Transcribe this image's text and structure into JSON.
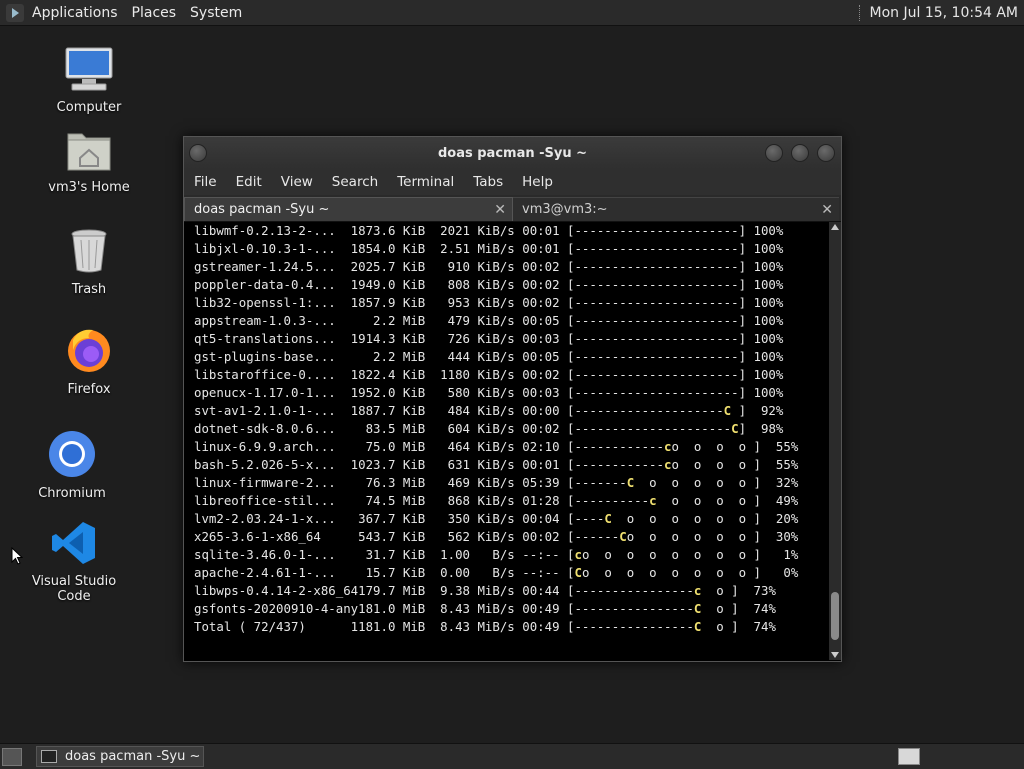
{
  "top_panel": {
    "menus": [
      "Applications",
      "Places",
      "System"
    ],
    "clock": "Mon Jul 15, 10:54 AM"
  },
  "desktop": {
    "icons": [
      {
        "label": "Computer",
        "icon": "computer-icon"
      },
      {
        "label": "vm3's Home",
        "icon": "home-folder-icon"
      },
      {
        "label": "Trash",
        "icon": "trash-icon"
      },
      {
        "label": "Firefox",
        "icon": "firefox-icon"
      },
      {
        "label": "Chromium",
        "icon": "chromium-icon"
      },
      {
        "label": "Visual Studio Code",
        "icon": "vscode-icon"
      }
    ]
  },
  "window": {
    "title": "doas pacman -Syu ~",
    "menu": [
      "File",
      "Edit",
      "View",
      "Search",
      "Terminal",
      "Tabs",
      "Help"
    ],
    "tabs": [
      {
        "label": "doas pacman -Syu ~",
        "active": true
      },
      {
        "label": "vm3@vm3:~",
        "active": false
      }
    ],
    "downloads": [
      {
        "name": "libwmf-0.2.13-2-...",
        "size": "1873.6 KiB",
        "rate": "2021 KiB/s",
        "time": "00:01",
        "bar": "[----------------------]",
        "pct": "100%"
      },
      {
        "name": "libjxl-0.10.3-1-...",
        "size": "1854.0 KiB",
        "rate": "2.51 MiB/s",
        "time": "00:01",
        "bar": "[----------------------]",
        "pct": "100%"
      },
      {
        "name": "gstreamer-1.24.5...",
        "size": "2025.7 KiB",
        "rate": " 910 KiB/s",
        "time": "00:02",
        "bar": "[----------------------]",
        "pct": "100%"
      },
      {
        "name": "poppler-data-0.4...",
        "size": "1949.0 KiB",
        "rate": " 808 KiB/s",
        "time": "00:02",
        "bar": "[----------------------]",
        "pct": "100%"
      },
      {
        "name": "lib32-openssl-1:...",
        "size": "1857.9 KiB",
        "rate": " 953 KiB/s",
        "time": "00:02",
        "bar": "[----------------------]",
        "pct": "100%"
      },
      {
        "name": "appstream-1.0.3-...",
        "size": "   2.2 MiB",
        "rate": " 479 KiB/s",
        "time": "00:05",
        "bar": "[----------------------]",
        "pct": "100%"
      },
      {
        "name": "qt5-translations...",
        "size": "1914.3 KiB",
        "rate": " 726 KiB/s",
        "time": "00:03",
        "bar": "[----------------------]",
        "pct": "100%"
      },
      {
        "name": "gst-plugins-base...",
        "size": "   2.2 MiB",
        "rate": " 444 KiB/s",
        "time": "00:05",
        "bar": "[----------------------]",
        "pct": "100%"
      },
      {
        "name": "libstaroffice-0....",
        "size": "1822.4 KiB",
        "rate": "1180 KiB/s",
        "time": "00:02",
        "bar": "[----------------------]",
        "pct": "100%"
      },
      {
        "name": "openucx-1.17.0-1...",
        "size": "1952.0 KiB",
        "rate": " 580 KiB/s",
        "time": "00:03",
        "bar": "[----------------------]",
        "pct": "100%"
      },
      {
        "name": "svt-av1-2.1.0-1-...",
        "size": "1887.7 KiB",
        "rate": " 484 KiB/s",
        "time": "00:00",
        "bar_pre": "[--------------------",
        "pac": "C",
        "bar_post": " ]",
        "pct": " 92%"
      },
      {
        "name": "dotnet-sdk-8.0.6...",
        "size": "  83.5 MiB",
        "rate": " 604 KiB/s",
        "time": "00:02",
        "bar_pre": "[---------------------",
        "pac": "C",
        "bar_post": "]",
        "pct": " 98%"
      },
      {
        "name": "linux-6.9.9.arch...",
        "size": "  75.0 MiB",
        "rate": " 464 KiB/s",
        "time": "02:10",
        "bar_pre": "[------------",
        "pac": "c",
        "bar_post": "o  o  o  o ]",
        "pct": " 55%"
      },
      {
        "name": "bash-5.2.026-5-x...",
        "size": "1023.7 KiB",
        "rate": " 631 KiB/s",
        "time": "00:01",
        "bar_pre": "[------------",
        "pac": "c",
        "bar_post": "o  o  o  o ]",
        "pct": " 55%"
      },
      {
        "name": "linux-firmware-2...",
        "size": "  76.3 MiB",
        "rate": " 469 KiB/s",
        "time": "05:39",
        "bar_pre": "[-------",
        "pac": "C",
        "bar_post": "  o  o  o  o  o ]",
        "pct": " 32%"
      },
      {
        "name": "libreoffice-stil...",
        "size": "  74.5 MiB",
        "rate": " 868 KiB/s",
        "time": "01:28",
        "bar_pre": "[----------",
        "pac": "c",
        "bar_post": "  o  o  o  o ]",
        "pct": " 49%"
      },
      {
        "name": "lvm2-2.03.24-1-x...",
        "size": " 367.7 KiB",
        "rate": " 350 KiB/s",
        "time": "00:04",
        "bar_pre": "[----",
        "pac": "C",
        "bar_post": "  o  o  o  o  o  o ]",
        "pct": " 20%"
      },
      {
        "name": "x265-3.6-1-x86_64",
        "size": " 543.7 KiB",
        "rate": " 562 KiB/s",
        "time": "00:02",
        "bar_pre": "[------",
        "pac": "C",
        "bar_post": "o  o  o  o  o  o ]",
        "pct": " 30%"
      },
      {
        "name": "sqlite-3.46.0-1-...",
        "size": "  31.7 KiB",
        "rate": "1.00   B/s",
        "time": "--:--",
        "bar_pre": "[",
        "pac": "c",
        "bar_post": "o  o  o  o  o  o  o  o ]",
        "pct": "  1%"
      },
      {
        "name": "apache-2.4.61-1-...",
        "size": "  15.7 KiB",
        "rate": "0.00   B/s",
        "time": "--:--",
        "bar_pre": "[",
        "pac": "C",
        "bar_post": "o  o  o  o  o  o  o  o ]",
        "pct": "  0%"
      },
      {
        "name": "libwps-0.4.14-2-x86_64",
        "size": "179.7 MiB",
        "rate": "9.38 MiB/s",
        "time": "00:44",
        "bar_pre": "[----------------",
        "pac": "c",
        "bar_post": "  o ]",
        "pct": " 73%"
      },
      {
        "name": "gsfonts-20200910-4-any",
        "size": "181.0 MiB",
        "rate": "8.43 MiB/s",
        "time": "00:49",
        "bar_pre": "[----------------",
        "pac": "C",
        "bar_post": "  o ]",
        "pct": " 74%"
      },
      {
        "name": "Total ( 72/437)",
        "size": "1181.0 MiB",
        "rate": "8.43 MiB/s",
        "time": "00:49",
        "bar_pre": "[----------------",
        "pac": "C",
        "bar_post": "  o ]",
        "pct": " 74%"
      }
    ]
  },
  "bottom_panel": {
    "task_label": "doas pacman -Syu ~"
  }
}
